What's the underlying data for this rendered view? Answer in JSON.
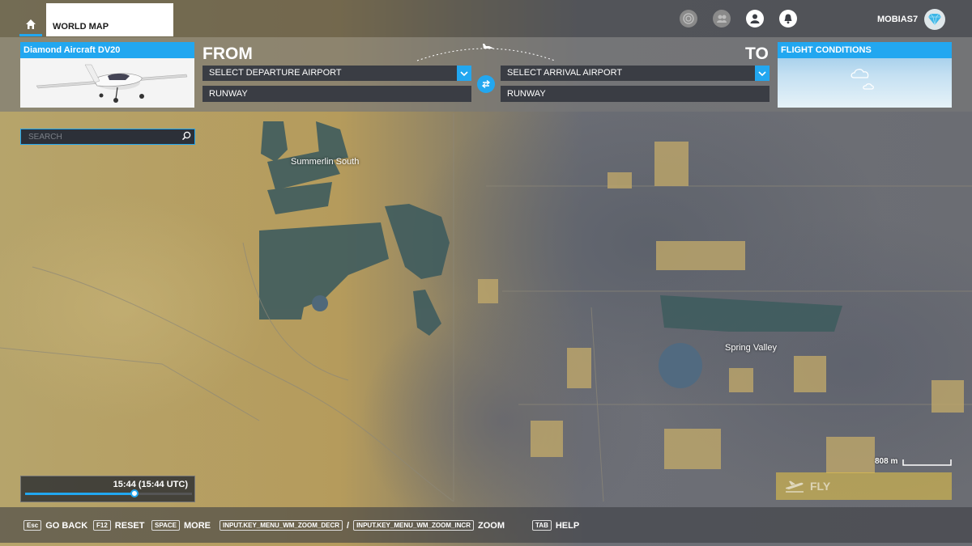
{
  "topbar": {
    "tab_label": "WORLD MAP",
    "username": "MOBIAS7",
    "icons": [
      "home-icon",
      "target-icon",
      "friends-icon",
      "profile-icon",
      "notification-icon",
      "gem-icon"
    ]
  },
  "aircraft": {
    "title": "Diamond Aircraft DV20"
  },
  "route": {
    "from_label": "FROM",
    "to_label": "TO",
    "departure_placeholder": "SELECT DEPARTURE AIRPORT",
    "arrival_placeholder": "SELECT ARRIVAL AIRPORT",
    "departure_runway": "RUNWAY",
    "arrival_runway": "RUNWAY"
  },
  "conditions": {
    "title": "FLIGHT CONDITIONS"
  },
  "search": {
    "placeholder": "SEARCH"
  },
  "map": {
    "labels": [
      "Summerlin South",
      "Spring Valley"
    ],
    "scale_text": "808 m"
  },
  "time": {
    "text": "15:44 (15:44 UTC)",
    "progress": 0.655
  },
  "fly": {
    "label": "FLY"
  },
  "hints": [
    {
      "key": "Esc",
      "label": "GO BACK"
    },
    {
      "key": "F12",
      "label": "RESET"
    },
    {
      "key": "SPACE",
      "label": "MORE"
    },
    {
      "key": "INPUT.KEY_MENU_WM_ZOOM_DECR",
      "label": ""
    },
    {
      "key": "INPUT.KEY_MENU_WM_ZOOM_INCR",
      "label": "ZOOM"
    },
    {
      "key": "TAB",
      "label": "HELP"
    }
  ],
  "hint_separator": "/",
  "colors": {
    "accent": "#22a7f0",
    "fly": "#ebc846"
  }
}
